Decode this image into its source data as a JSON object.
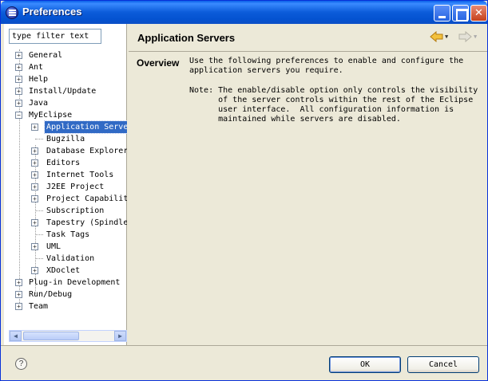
{
  "window": {
    "title": "Preferences"
  },
  "filter": {
    "value": "type filter text"
  },
  "tree": [
    {
      "label": "General"
    },
    {
      "label": "Ant"
    },
    {
      "label": "Help"
    },
    {
      "label": "Install/Update"
    },
    {
      "label": "Java"
    },
    {
      "label": "MyEclipse"
    },
    {
      "label": "Application Serve"
    },
    {
      "label": "Bugzilla"
    },
    {
      "label": "Database Explorer"
    },
    {
      "label": "Editors"
    },
    {
      "label": "Internet Tools"
    },
    {
      "label": "J2EE Project"
    },
    {
      "label": "Project Capabilit"
    },
    {
      "label": "Subscription"
    },
    {
      "label": "Tapestry (Spindle"
    },
    {
      "label": "Task Tags"
    },
    {
      "label": "UML"
    },
    {
      "label": "Validation"
    },
    {
      "label": "XDoclet"
    },
    {
      "label": "Plug-in Development"
    },
    {
      "label": "Run/Debug"
    },
    {
      "label": "Team"
    }
  ],
  "page": {
    "title": "Application Servers",
    "overview_label": "Overview",
    "overview_text": "Use the following preferences to enable and configure the\napplication servers you require.",
    "note_text": "Note: The enable/disable option only controls the visibility\n      of the server controls within the rest of the Eclipse\n      user interface.  All configuration information is\n      maintained while servers are disabled."
  },
  "buttons": {
    "ok": "OK",
    "cancel": "Cancel"
  },
  "icons": {
    "title": "eclipse-icon",
    "back": "back-arrow-icon",
    "forward": "forward-arrow-icon",
    "help": "help-icon"
  },
  "colors": {
    "titlebar": "#0b5bd9",
    "selection": "#316ac5",
    "back_arrow": "#e8a419"
  }
}
